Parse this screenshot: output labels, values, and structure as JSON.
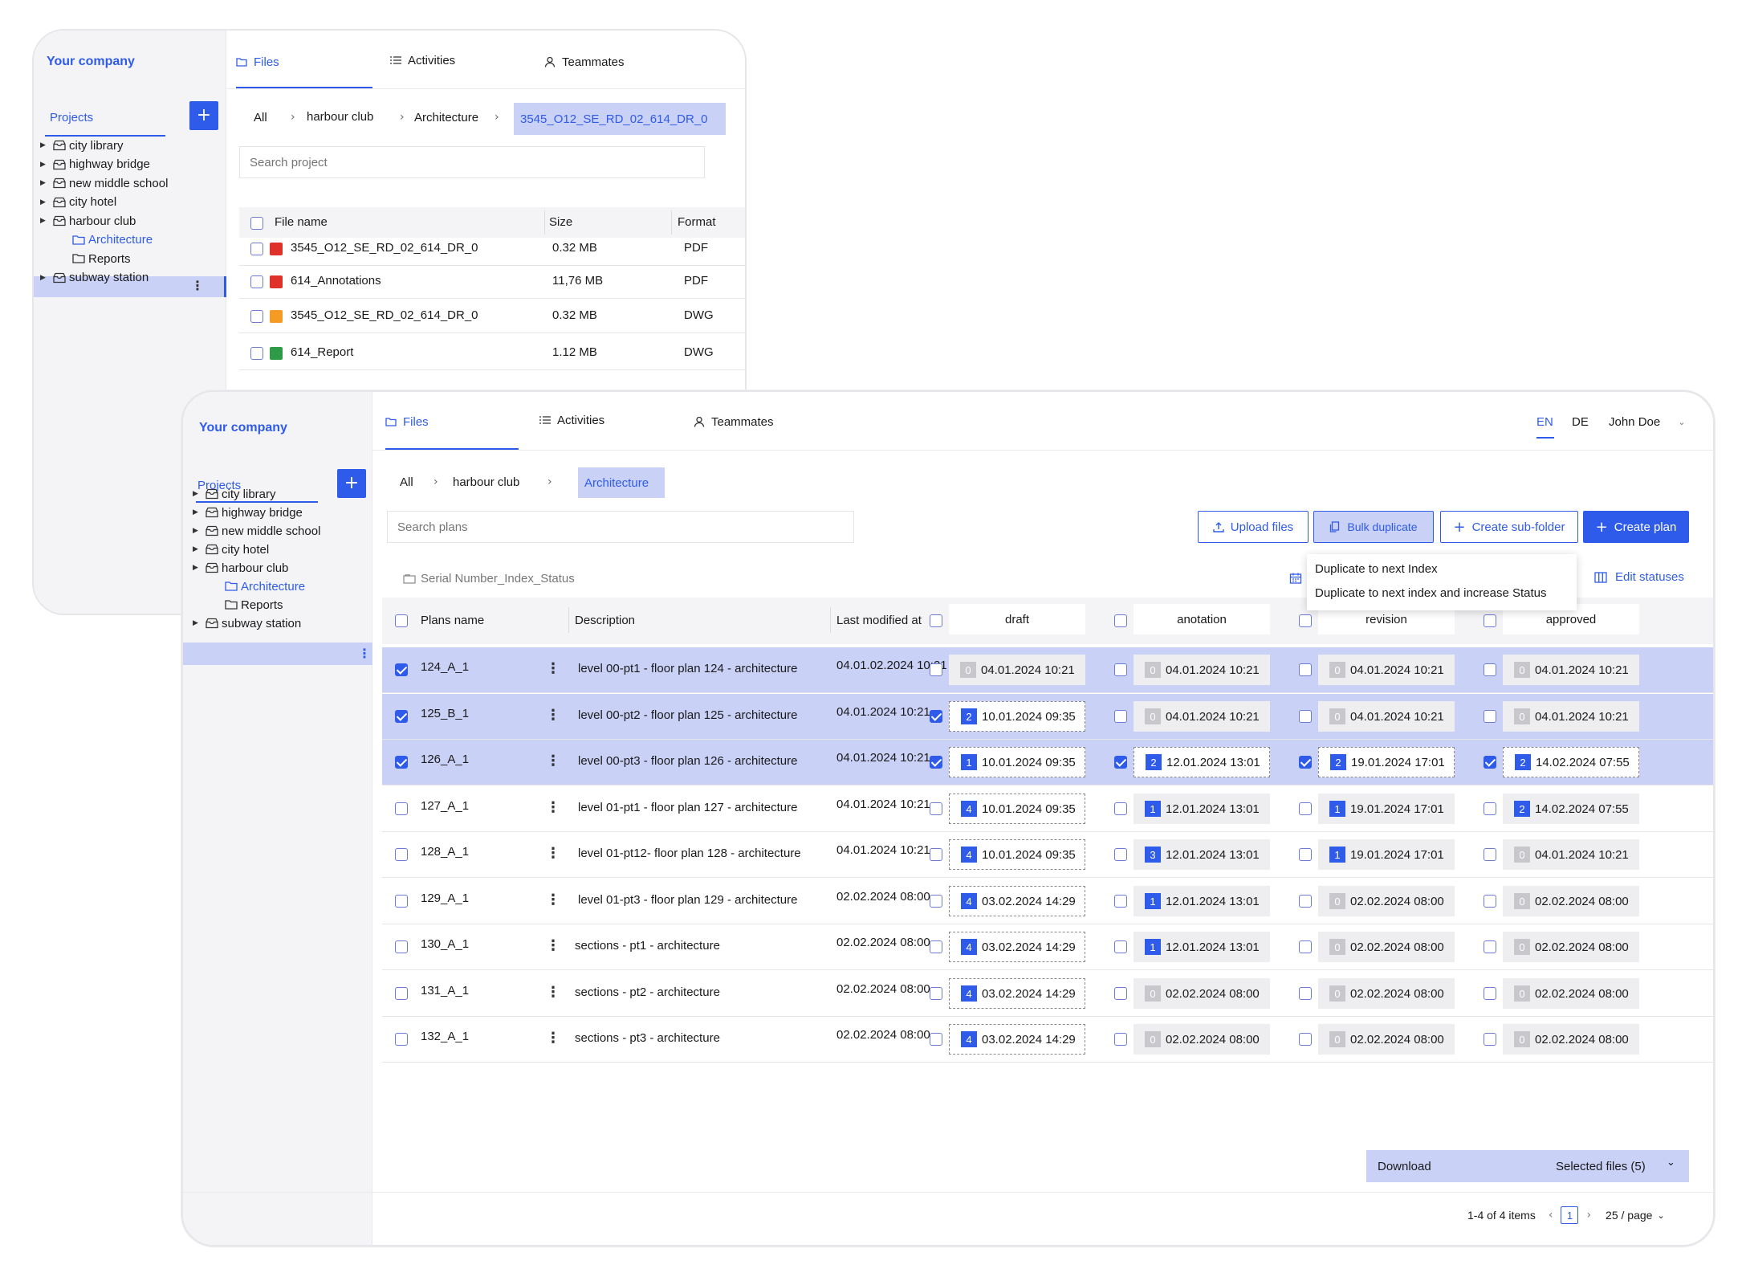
{
  "colors": {
    "accent": "#2f5bea",
    "selected_row": "#c9d1f7",
    "sidebar_bg": "#f4f4f6",
    "pdf_icon": "#e0302a",
    "image_icon": "#f59a23",
    "dwg_icon": "#2e9b48"
  },
  "back_window": {
    "company": "Your company",
    "tabs": [
      {
        "label": "Files",
        "icon": "folder-icon"
      },
      {
        "label": "Activities",
        "icon": "list-icon"
      },
      {
        "label": "Teammates",
        "icon": "user-icon"
      }
    ],
    "projects_label": "Projects",
    "add_label": "+",
    "tree": [
      "city library",
      "highway bridge",
      "new middle school",
      "city hotel",
      "harbour club",
      "Architecture",
      "Reports",
      "subway station"
    ],
    "breadcrumb": [
      "All",
      "harbour club",
      "Architecture",
      "3545_O12_SE_RD_02_614_DR_0"
    ],
    "search_placeholder": "Search project",
    "columns": [
      "File name",
      "Size",
      "Format"
    ],
    "files": [
      {
        "name": "3545_O12_SE_RD_02_614_DR_0",
        "size": "0.32 MB",
        "format": "PDF",
        "icon": "pdf-icon"
      },
      {
        "name": "614_Annotations",
        "size": "11,76 MB",
        "format": "PDF",
        "icon": "pdf-icon"
      },
      {
        "name": "3545_O12_SE_RD_02_614_DR_0",
        "size": "0.32 MB",
        "format": "DWG",
        "icon": "image-icon"
      },
      {
        "name": "614_Report",
        "size": "1.12 MB",
        "format": "DWG",
        "icon": "dwg-icon"
      }
    ]
  },
  "front_window": {
    "company": "Your company",
    "tabs": [
      {
        "label": "Files",
        "icon": "folder-icon"
      },
      {
        "label": "Activities",
        "icon": "list-icon"
      },
      {
        "label": "Teammates",
        "icon": "user-icon"
      }
    ],
    "lang": [
      "EN",
      "DE"
    ],
    "user": "John  Doe",
    "projects_label": "Projects",
    "add_label": "+",
    "tree": [
      "city library",
      "highway bridge",
      "new middle school",
      "city hotel",
      "harbour club",
      "Architecture",
      "Reports",
      "subway station"
    ],
    "breadcrumb": [
      "All",
      "harbour club",
      "Architecture"
    ],
    "search_placeholder": "Search plans",
    "toolbar": {
      "upload": "Upload files",
      "bulk": "Bulk duplicate",
      "subfolder": "Create sub-folder",
      "create": "Create plan"
    },
    "menu": [
      "Duplicate to next Index",
      "Duplicate to next index and increase Status"
    ],
    "naming": "Serial Number_Index_Status",
    "edit_statuses": "Edit statuses",
    "columns": [
      "Plans name",
      "Description",
      "Last modified at"
    ],
    "statuses": [
      "draft",
      "anotation",
      "revision",
      "approved"
    ],
    "rows": [
      {
        "name": "124_A_1",
        "desc": "level 00-pt1 - floor plan 124 - architecture",
        "modified": "04.01.02.2024 10:21",
        "selected": true,
        "s": [
          {
            "n": "0",
            "d": "04.01.2024 10:21",
            "b": false,
            "c": false,
            "h": false
          },
          {
            "n": "0",
            "d": "04.01.2024 10:21",
            "b": false,
            "c": false,
            "h": false
          },
          {
            "n": "0",
            "d": "04.01.2024 10:21",
            "b": false,
            "c": false,
            "h": false
          },
          {
            "n": "0",
            "d": "04.01.2024 10:21",
            "b": false,
            "c": false,
            "h": false
          }
        ]
      },
      {
        "name": "125_B_1",
        "desc": "level 00-pt2 - floor plan 125 - architecture",
        "modified": "04.01.2024 10:21",
        "selected": true,
        "s": [
          {
            "n": "2",
            "d": "10.01.2024 09:35",
            "b": true,
            "c": true,
            "h": true
          },
          {
            "n": "0",
            "d": "04.01.2024 10:21",
            "b": false,
            "c": false,
            "h": false
          },
          {
            "n": "0",
            "d": "04.01.2024 10:21",
            "b": false,
            "c": false,
            "h": false
          },
          {
            "n": "0",
            "d": "04.01.2024 10:21",
            "b": false,
            "c": false,
            "h": false
          }
        ]
      },
      {
        "name": "126_A_1",
        "desc": "level 00-pt3 - floor plan 126 - architecture",
        "modified": "04.01.2024 10:21",
        "selected": true,
        "s": [
          {
            "n": "1",
            "d": "10.01.2024 09:35",
            "b": true,
            "c": true,
            "h": true
          },
          {
            "n": "2",
            "d": "12.01.2024 13:01",
            "b": true,
            "c": true,
            "h": true
          },
          {
            "n": "2",
            "d": "19.01.2024 17:01",
            "b": true,
            "c": true,
            "h": true
          },
          {
            "n": "2",
            "d": "14.02.2024 07:55",
            "b": true,
            "c": true,
            "h": true
          }
        ]
      },
      {
        "name": "127_A_1",
        "desc": "level 01-pt1 - floor plan 127 - architecture",
        "modified": "04.01.2024 10:21",
        "selected": false,
        "s": [
          {
            "n": "4",
            "d": "10.01.2024 09:35",
            "b": true,
            "c": false,
            "h": true
          },
          {
            "n": "1",
            "d": "12.01.2024 13:01",
            "b": true,
            "c": false,
            "h": false
          },
          {
            "n": "1",
            "d": "19.01.2024 17:01",
            "b": true,
            "c": false,
            "h": false
          },
          {
            "n": "2",
            "d": "14.02.2024 07:55",
            "b": true,
            "c": false,
            "h": false
          }
        ]
      },
      {
        "name": "128_A_1",
        "desc": "level 01-pt12- floor plan 128 - architecture",
        "modified": "04.01.2024 10:21",
        "selected": false,
        "s": [
          {
            "n": "4",
            "d": "10.01.2024 09:35",
            "b": true,
            "c": false,
            "h": true
          },
          {
            "n": "3",
            "d": "12.01.2024 13:01",
            "b": true,
            "c": false,
            "h": false
          },
          {
            "n": "1",
            "d": "19.01.2024 17:01",
            "b": true,
            "c": false,
            "h": false
          },
          {
            "n": "0",
            "d": "04.01.2024 10:21",
            "b": false,
            "c": false,
            "h": false
          }
        ]
      },
      {
        "name": "129_A_1",
        "desc": "level 01-pt3 - floor plan 129 - architecture",
        "modified": "02.02.2024 08:00",
        "selected": false,
        "s": [
          {
            "n": "4",
            "d": "03.02.2024 14:29",
            "b": true,
            "c": false,
            "h": true
          },
          {
            "n": "1",
            "d": "12.01.2024 13:01",
            "b": true,
            "c": false,
            "h": false
          },
          {
            "n": "0",
            "d": "02.02.2024 08:00",
            "b": false,
            "c": false,
            "h": false
          },
          {
            "n": "0",
            "d": "02.02.2024 08:00",
            "b": false,
            "c": false,
            "h": false
          }
        ]
      },
      {
        "name": "130_A_1",
        "desc": "sections - pt1 - architecture",
        "modified": "02.02.2024 08:00",
        "selected": false,
        "s": [
          {
            "n": "4",
            "d": "03.02.2024 14:29",
            "b": true,
            "c": false,
            "h": true
          },
          {
            "n": "1",
            "d": "12.01.2024 13:01",
            "b": true,
            "c": false,
            "h": false
          },
          {
            "n": "0",
            "d": "02.02.2024 08:00",
            "b": false,
            "c": false,
            "h": false
          },
          {
            "n": "0",
            "d": "02.02.2024 08:00",
            "b": false,
            "c": false,
            "h": false
          }
        ]
      },
      {
        "name": "131_A_1",
        "desc": "sections - pt2 - architecture",
        "modified": "02.02.2024 08:00",
        "selected": false,
        "s": [
          {
            "n": "4",
            "d": "03.02.2024 14:29",
            "b": true,
            "c": false,
            "h": true
          },
          {
            "n": "0",
            "d": "02.02.2024 08:00",
            "b": false,
            "c": false,
            "h": false
          },
          {
            "n": "0",
            "d": "02.02.2024 08:00",
            "b": false,
            "c": false,
            "h": false
          },
          {
            "n": "0",
            "d": "02.02.2024 08:00",
            "b": false,
            "c": false,
            "h": false
          }
        ]
      },
      {
        "name": "132_A_1",
        "desc": "sections - pt3 - architecture",
        "modified": "02.02.2024 08:00",
        "selected": false,
        "s": [
          {
            "n": "4",
            "d": "03.02.2024 14:29",
            "b": true,
            "c": false,
            "h": true
          },
          {
            "n": "0",
            "d": "02.02.2024 08:00",
            "b": false,
            "c": false,
            "h": false
          },
          {
            "n": "0",
            "d": "02.02.2024 08:00",
            "b": false,
            "c": false,
            "h": false
          },
          {
            "n": "0",
            "d": "02.02.2024 08:00",
            "b": false,
            "c": false,
            "h": false
          }
        ]
      }
    ],
    "download": {
      "label": "Download",
      "selected": "Selected files (5)"
    },
    "pagination": {
      "range": "1-4 of 4 items",
      "page": "1",
      "per_page": "25 / page"
    }
  }
}
